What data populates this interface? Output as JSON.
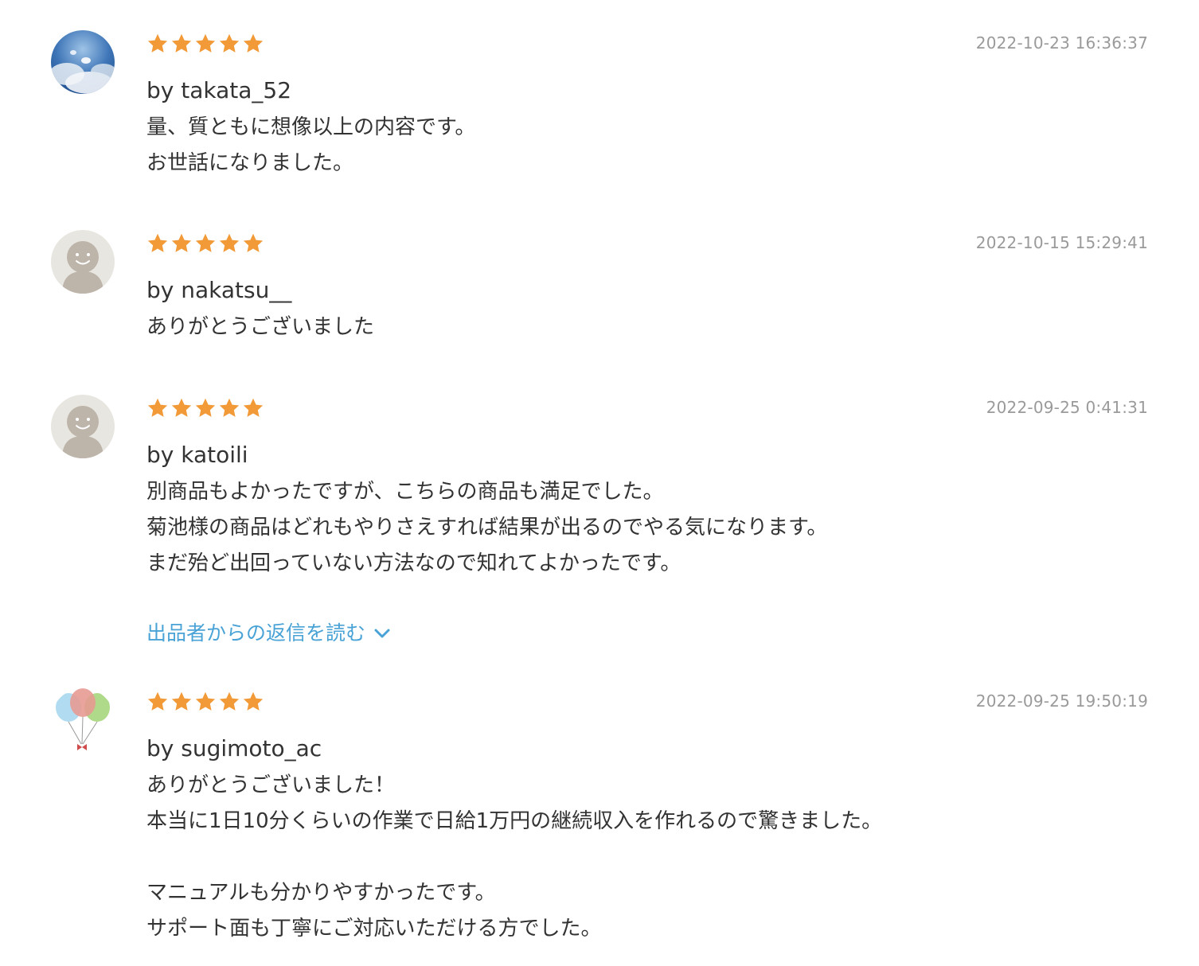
{
  "colors": {
    "star": "#f29a38",
    "timestamp": "#9a9a9a",
    "text": "#333333",
    "link": "#4aa3d6"
  },
  "reviews": [
    {
      "avatar": "sky-photo-avatar",
      "rating": 5,
      "timestamp": "2022-10-23 16:36:37",
      "reviewer": "by takata_52",
      "lines": [
        "量、質ともに想像以上の内容です。",
        "お世話になりました。"
      ]
    },
    {
      "avatar": "default-person-avatar",
      "rating": 5,
      "timestamp": "2022-10-15 15:29:41",
      "reviewer": "by nakatsu__",
      "lines": [
        "ありがとうございました"
      ]
    },
    {
      "avatar": "default-person-avatar",
      "rating": 5,
      "timestamp": "2022-09-25 0:41:31",
      "reviewer": "by katoili",
      "lines": [
        "別商品もよかったですが、こちらの商品も満足でした。",
        "菊池様の商品はどれもやりさえすれば結果が出るのでやる気になります。",
        "まだ殆ど出回っていない方法なので知れてよかったです。"
      ],
      "reply_link": "出品者からの返信を読む"
    },
    {
      "avatar": "balloons-avatar",
      "rating": 5,
      "timestamp": "2022-09-25 19:50:19",
      "reviewer": "by sugimoto_ac",
      "lines": [
        "ありがとうございました！",
        "本当に1日10分くらいの作業で日給1万円の継続収入を作れるので驚きました。",
        "",
        "マニュアルも分かりやすかったです。",
        "サポート面も丁寧にご対応いただける方でした。"
      ]
    }
  ]
}
